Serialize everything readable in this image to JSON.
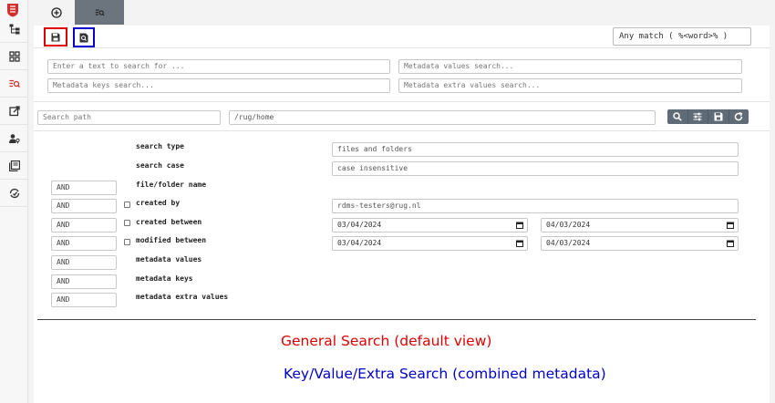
{
  "toolbar": {
    "any_match": "Any match ( %<word>% )"
  },
  "search": {
    "text_placeholder": "Enter a text to search for ...",
    "meta_values_placeholder": "Metadata values search...",
    "meta_keys_placeholder": "Metadata keys search...",
    "meta_extra_placeholder": "Metadata extra values search...",
    "path_placeholder": "Search path",
    "path_value": "/rug/home"
  },
  "criteria": {
    "search_type_label": "search type",
    "search_type_value": "files and folders",
    "search_case_label": "search case",
    "search_case_value": "case insensitive",
    "file_folder_label": "file/folder name",
    "created_by_label": "created by",
    "created_by_value": "rdms-testers@rug.nl",
    "created_between_label": "created between",
    "created_from": "03/04/2024",
    "created_to": "04/03/2024",
    "modified_between_label": "modified between",
    "modified_from": "03/04/2024",
    "modified_to": "04/03/2024",
    "metadata_values_label": "metadata values",
    "metadata_keys_label": "metadata keys",
    "metadata_extra_label": "metadata extra values",
    "operators": [
      "AND",
      "AND",
      "AND",
      "AND",
      "AND",
      "AND",
      "AND"
    ]
  },
  "captions": {
    "general": "General Search (default view)",
    "keyvalue": "Key/Value/Extra Search (combined metadata)"
  },
  "colors": {
    "highlight_general": "#e00000",
    "highlight_keyvalue": "#0000cc",
    "button_group": "#5f6b76",
    "active_tab": "#6c757d"
  },
  "icons": {
    "rail": [
      "university-logo",
      "tree-icon",
      "grid-icon",
      "search-list-icon",
      "external-link-icon",
      "user-key-icon",
      "books-icon",
      "sync-icon"
    ],
    "tabbar": [
      "add-circle-icon",
      "search-list-icon"
    ],
    "views": [
      "save-icon",
      "doc-search-icon"
    ],
    "actions": [
      "search-icon",
      "sliders-icon",
      "save-icon",
      "refresh-icon"
    ]
  }
}
